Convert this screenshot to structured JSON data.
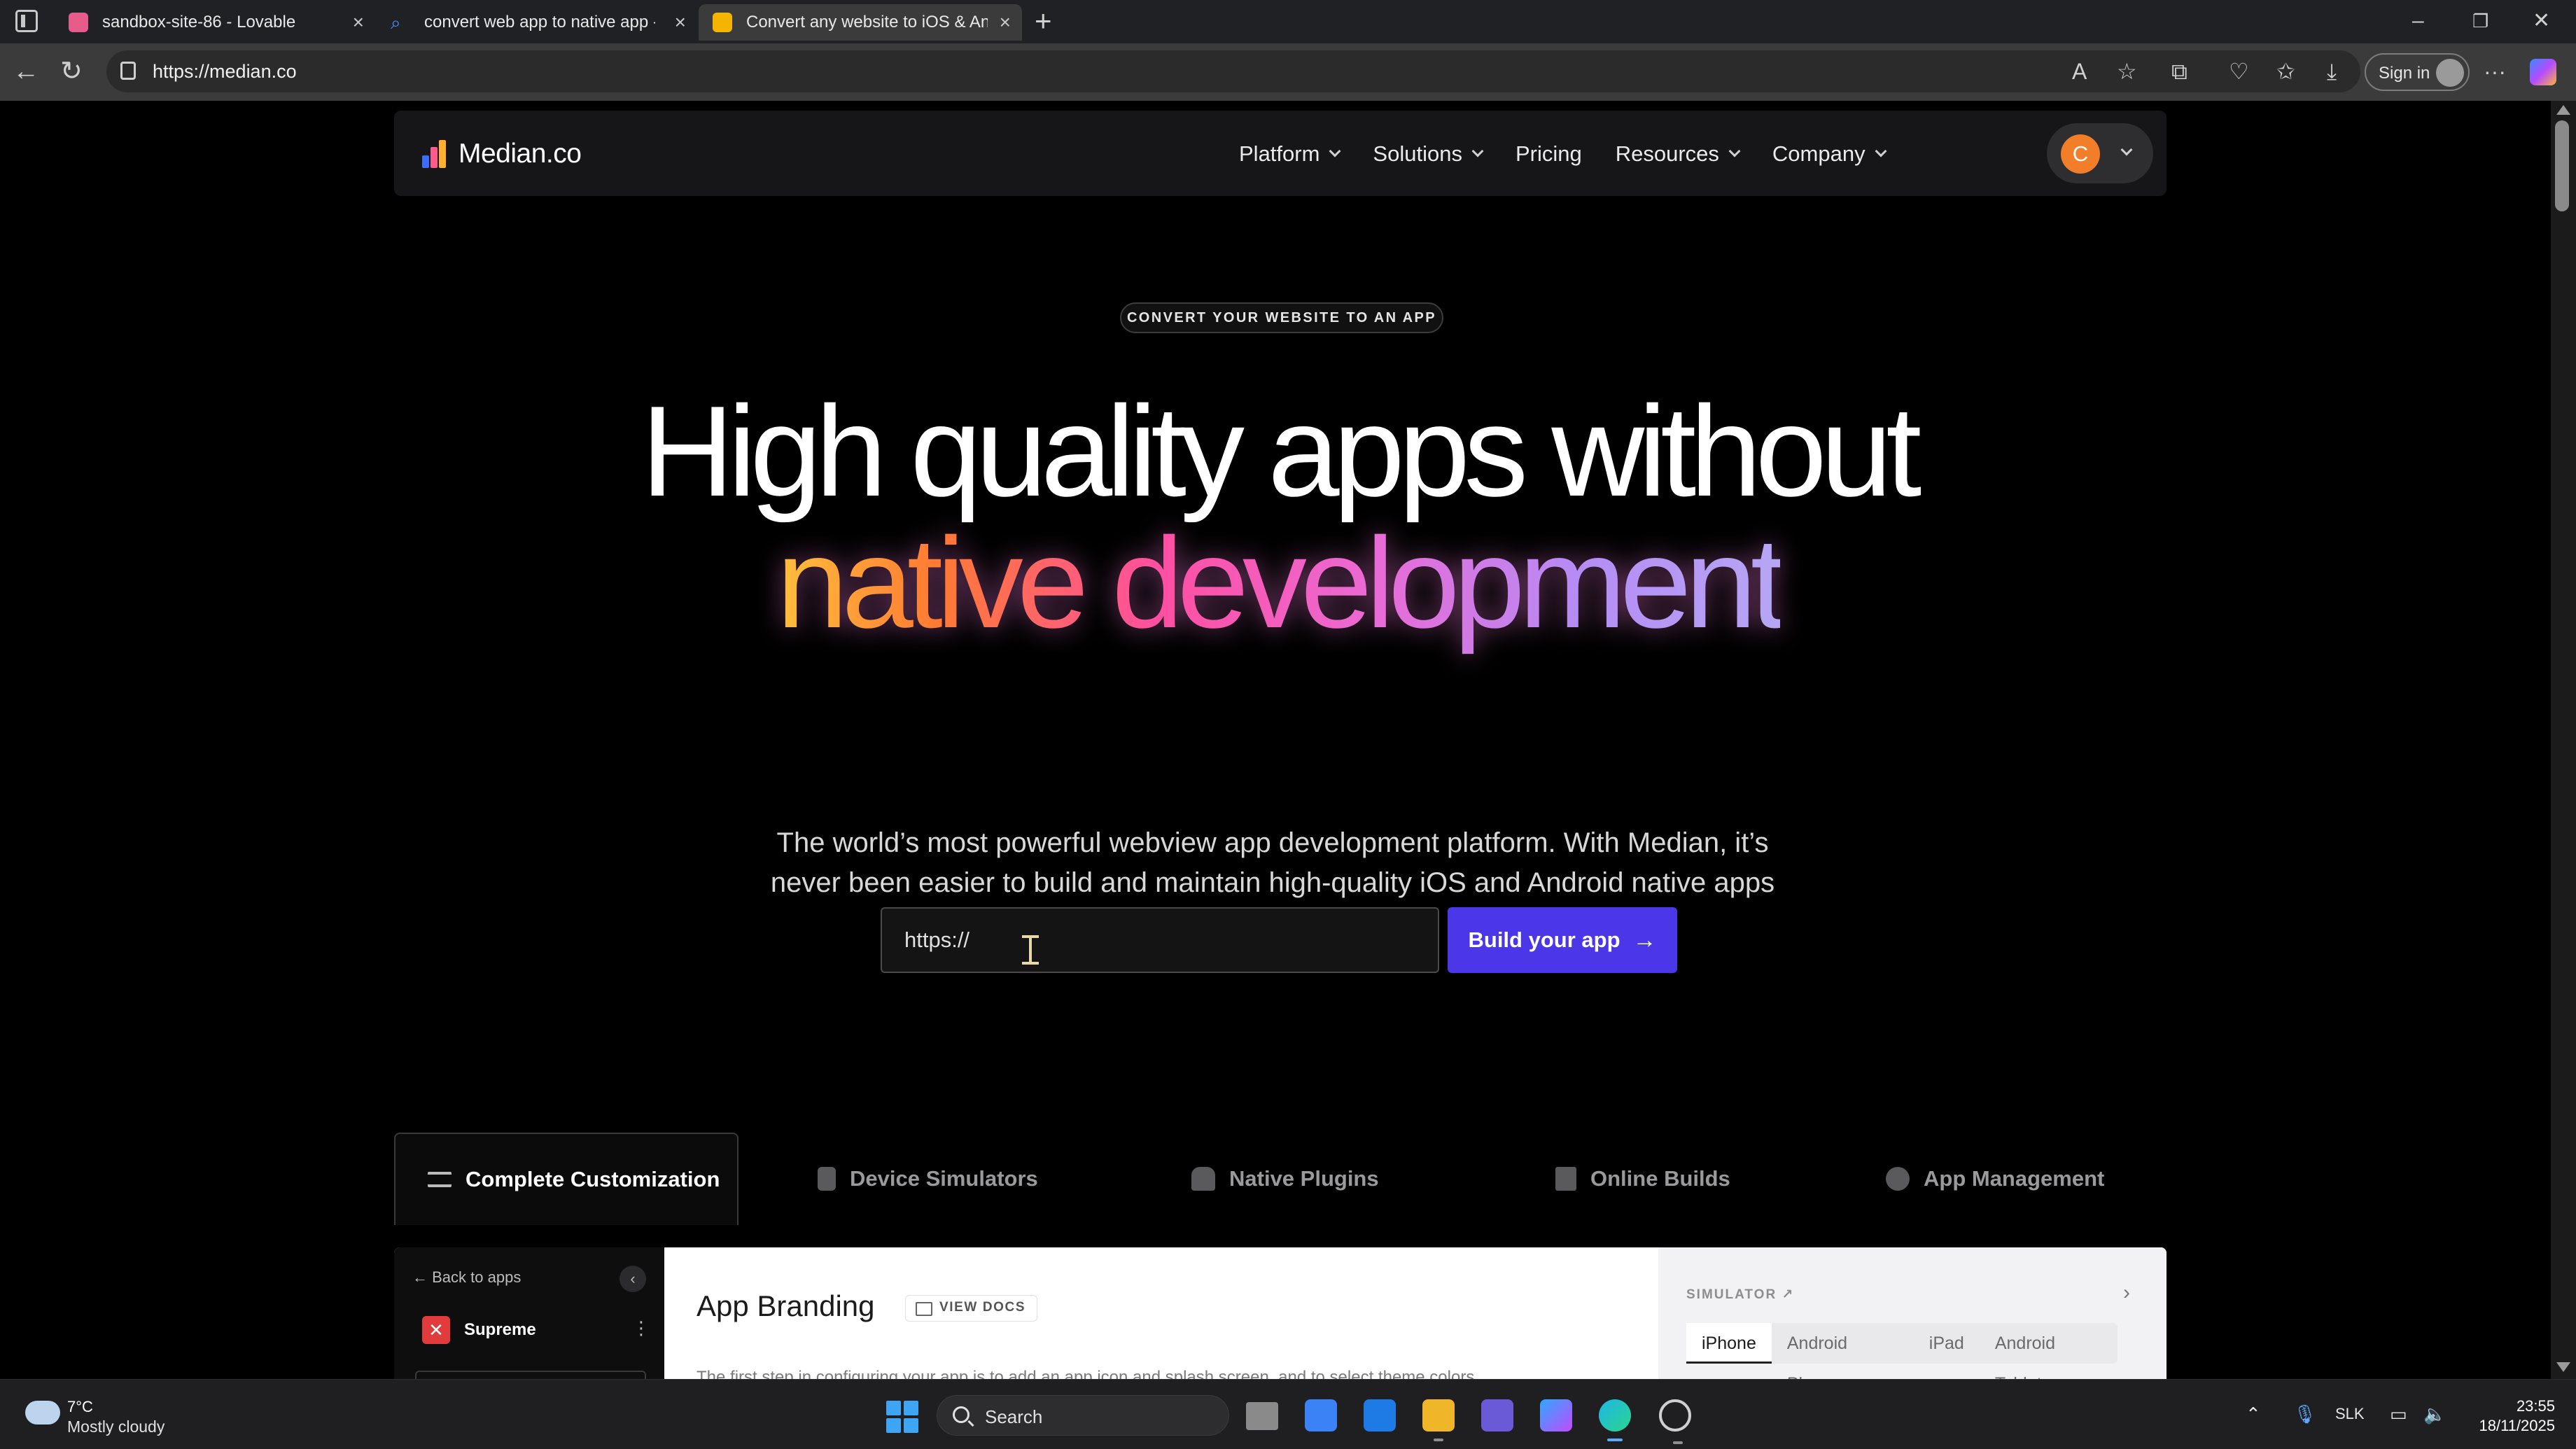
{
  "browser": {
    "tabs": [
      {
        "title": "sandbox-site-86 - Lovable",
        "favicon_color": "#e85c8c"
      },
      {
        "title": "convert web app to native app - I",
        "favicon_color": "#4f8ef7"
      },
      {
        "title": "Convert any website to iOS & An",
        "favicon_color": "#f5b400"
      }
    ],
    "new_tab_label": "+",
    "url": "https://median.co",
    "sign_in_label": "Sign in"
  },
  "site": {
    "logo_text": "Median.co",
    "nav": [
      {
        "label": "Platform",
        "has_dropdown": true
      },
      {
        "label": "Solutions",
        "has_dropdown": true
      },
      {
        "label": "Pricing",
        "has_dropdown": false
      },
      {
        "label": "Resources",
        "has_dropdown": true
      },
      {
        "label": "Company",
        "has_dropdown": true
      }
    ],
    "user_initial": "C",
    "accent_color": "#4b37e8"
  },
  "hero": {
    "badge": "CONVERT YOUR WEBSITE TO AN APP",
    "headline_line1": "High quality apps without",
    "headline_line2": "native development",
    "subtitle": "The world’s most powerful webview app development platform. With Median, it’s never been easier to build and maintain high-quality iOS and Android native apps powered by web content.",
    "url_input_placeholder": "https://",
    "cta_label": "Build your app",
    "cta_arrow": "→"
  },
  "feature_tabs": [
    {
      "label": "Complete Customization",
      "icon": "sliders-icon",
      "active": true
    },
    {
      "label": "Device Simulators",
      "icon": "phone-icon",
      "active": false
    },
    {
      "label": "Native Plugins",
      "icon": "puzzle-icon",
      "active": false
    },
    {
      "label": "Online Builds",
      "icon": "build-icon",
      "active": false
    },
    {
      "label": "App Management",
      "icon": "gear-icon",
      "active": false
    }
  ],
  "preview": {
    "back_label": "Back to apps",
    "collapse_icon": "‹",
    "app_name": "Supreme",
    "section_title": "App Branding",
    "view_docs_label": "VIEW DOCS",
    "description": "The first step in configuring your app is to add an app icon and splash screen, and to select theme colors",
    "simulator_label": "SIMULATOR",
    "simulator_chevron": "›",
    "devices": [
      {
        "label": "iPhone",
        "active": true
      },
      {
        "label": "Android Phone",
        "active": false
      },
      {
        "label": "iPad",
        "active": false
      },
      {
        "label": "Android Tablet",
        "active": false
      }
    ]
  },
  "taskbar": {
    "weather_temp": "7°C",
    "weather_desc": "Mostly cloudy",
    "search_label": "Search",
    "language": "SLK",
    "time": "23:55",
    "date": "18/11/2025"
  }
}
